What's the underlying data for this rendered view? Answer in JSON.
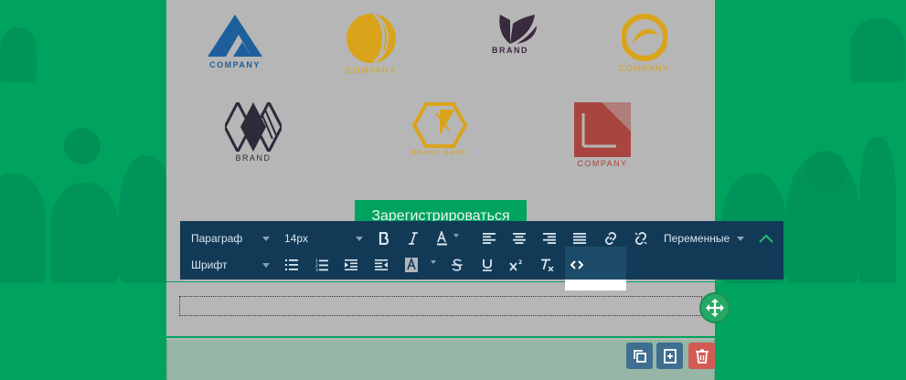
{
  "logos": [
    {
      "caption": "COMPANY",
      "color": "#1c5f9c"
    },
    {
      "caption": "COMPANY",
      "color": "#d9a419"
    },
    {
      "caption": "BRAND",
      "color": "#3a2a3e"
    },
    {
      "caption": "COMPANY",
      "color": "#d9a419"
    },
    {
      "caption": "BRAND",
      "color": "#2f2a3a"
    },
    {
      "caption": "BRAND NAME",
      "color": "#d9a419"
    },
    {
      "caption": "COMPANY",
      "color": "#a8453f"
    }
  ],
  "register_button": {
    "label": "Зарегистрироваться"
  },
  "toolbar": {
    "paragraph_select": "Параграф",
    "font_size_select": "14px",
    "font_select": "Шрифт",
    "variables_select": "Переменные"
  },
  "colors": {
    "background": "#00a35e",
    "toolbar": "#123a57",
    "panel": "#b6b6b6"
  }
}
